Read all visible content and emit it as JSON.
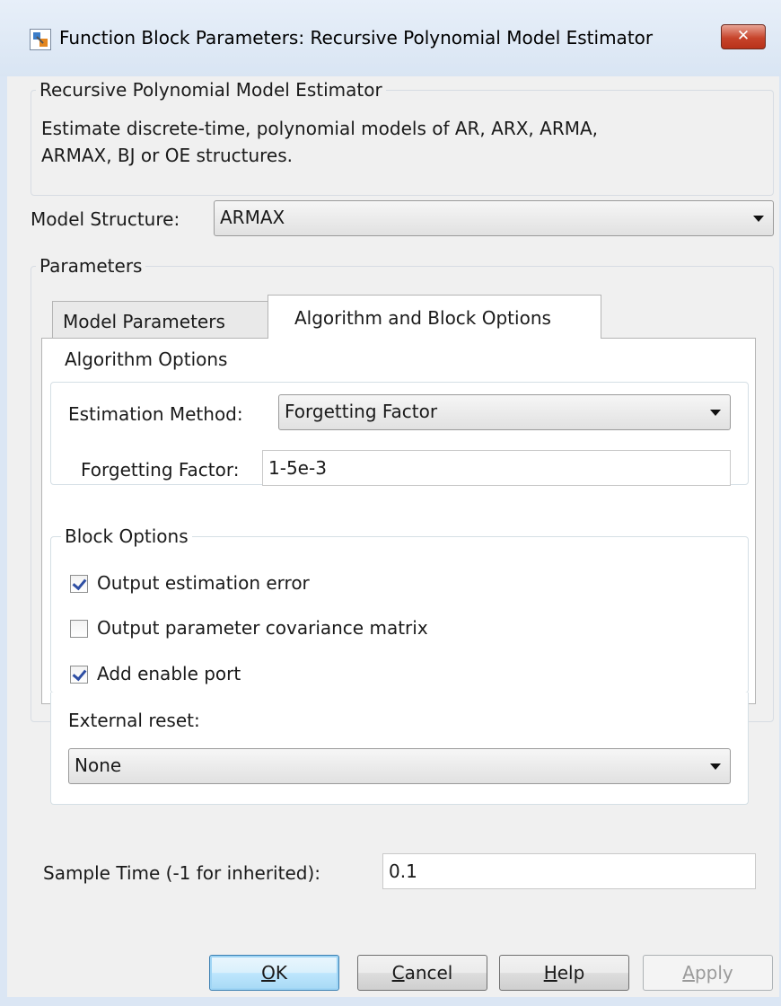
{
  "window": {
    "title": "Function Block Parameters: Recursive Polynomial Model Estimator"
  },
  "description": {
    "group_title": "Recursive Polynomial Model Estimator",
    "text_line1": "Estimate discrete-time, polynomial models of AR, ARX, ARMA,",
    "text_line2": "ARMAX, BJ or OE structures."
  },
  "model_structure": {
    "label": "Model Structure:",
    "value": "ARMAX"
  },
  "parameters": {
    "group_title": "Parameters",
    "tabs": [
      {
        "label": "Model Parameters",
        "active": false
      },
      {
        "label": "Algorithm and Block Options",
        "active": true
      }
    ]
  },
  "algorithm_options": {
    "group_title": "Algorithm Options",
    "estimation_method_label": "Estimation Method:",
    "estimation_method_value": "Forgetting Factor",
    "forgetting_factor_label": "Forgetting Factor:",
    "forgetting_factor_value": "1-5e-3"
  },
  "block_options": {
    "group_title": "Block Options",
    "checkboxes": [
      {
        "label": "Output estimation error",
        "checked": true
      },
      {
        "label": "Output parameter covariance matrix",
        "checked": false
      },
      {
        "label": "Add enable port",
        "checked": true
      }
    ],
    "external_reset_label": "External reset:",
    "external_reset_value": "None"
  },
  "sample_time": {
    "label": "Sample Time (-1 for inherited):",
    "value": "0.1"
  },
  "buttons": {
    "ok": {
      "mnemonic": "O",
      "rest": "K"
    },
    "cancel": {
      "mnemonic": "C",
      "rest": "ancel"
    },
    "help": {
      "mnemonic": "H",
      "rest": "elp"
    },
    "apply": {
      "mnemonic": "A",
      "rest": "pply"
    }
  },
  "icons": {
    "app": "simulink-block-icon",
    "close": "close-icon",
    "dropdown": "chevron-down-icon",
    "check": "checkmark-icon"
  },
  "colors": {
    "close_button": "#c7442b",
    "default_button_border": "#3c7fb1",
    "checkmark": "#2e4ea3"
  }
}
